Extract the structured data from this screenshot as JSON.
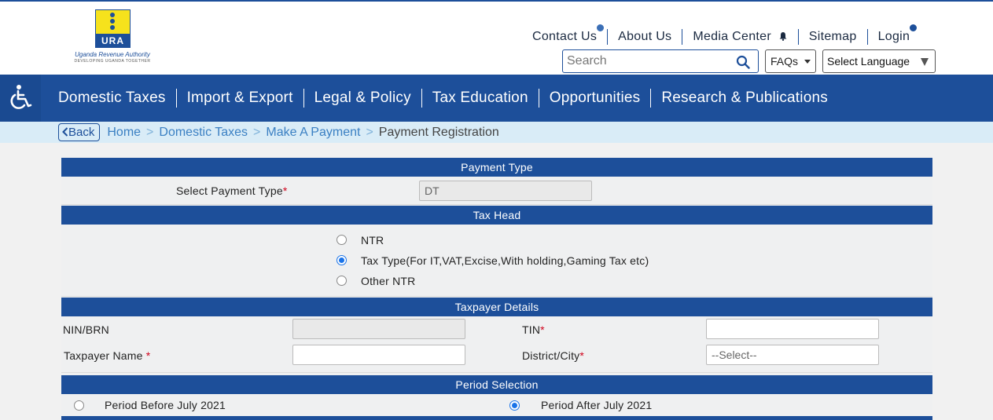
{
  "header": {
    "logo": {
      "abbr": "URA",
      "name": "Uganda Revenue Authority",
      "tagline": "DEVELOPING UGANDA TOGETHER"
    },
    "top_links": [
      "Contact Us",
      "About Us",
      "Media Center",
      "Sitemap",
      "Login"
    ],
    "search": {
      "placeholder": "Search"
    },
    "faqs_label": "FAQs",
    "language_label": "Select Language"
  },
  "nav": {
    "items": [
      "Domestic Taxes",
      "Import & Export",
      "Legal & Policy",
      "Tax Education",
      "Opportunities",
      "Research & Publications"
    ]
  },
  "breadcrumb": {
    "back_label": "Back",
    "items": [
      "Home",
      "Domestic Taxes",
      "Make A Payment"
    ],
    "current": "Payment Registration"
  },
  "form": {
    "payment_type": {
      "heading": "Payment Type",
      "label": "Select Payment Type",
      "value": "DT"
    },
    "tax_head": {
      "heading": "Tax Head",
      "options": [
        {
          "label": "NTR",
          "selected": false
        },
        {
          "label": "Tax Type(For IT,VAT,Excise,With holding,Gaming Tax etc)",
          "selected": true
        },
        {
          "label": "Other NTR",
          "selected": false
        }
      ]
    },
    "taxpayer": {
      "heading": "Taxpayer Details",
      "nin_label": "NIN/BRN",
      "nin_value": "",
      "tin_label": "TIN",
      "tin_value": "",
      "name_label": "Taxpayer Name ",
      "name_value": "",
      "district_label": "District/City",
      "district_value": "--Select--"
    },
    "period": {
      "heading": "Period Selection",
      "options": [
        {
          "label": "Period Before July 2021",
          "selected": false
        },
        {
          "label": "Period After July 2021",
          "selected": true
        }
      ]
    }
  },
  "colors": {
    "brand_blue": "#1d4f9a",
    "logo_yellow": "#f6e21c",
    "required_red": "#d0021b",
    "radio_blue": "#1a73e8"
  }
}
